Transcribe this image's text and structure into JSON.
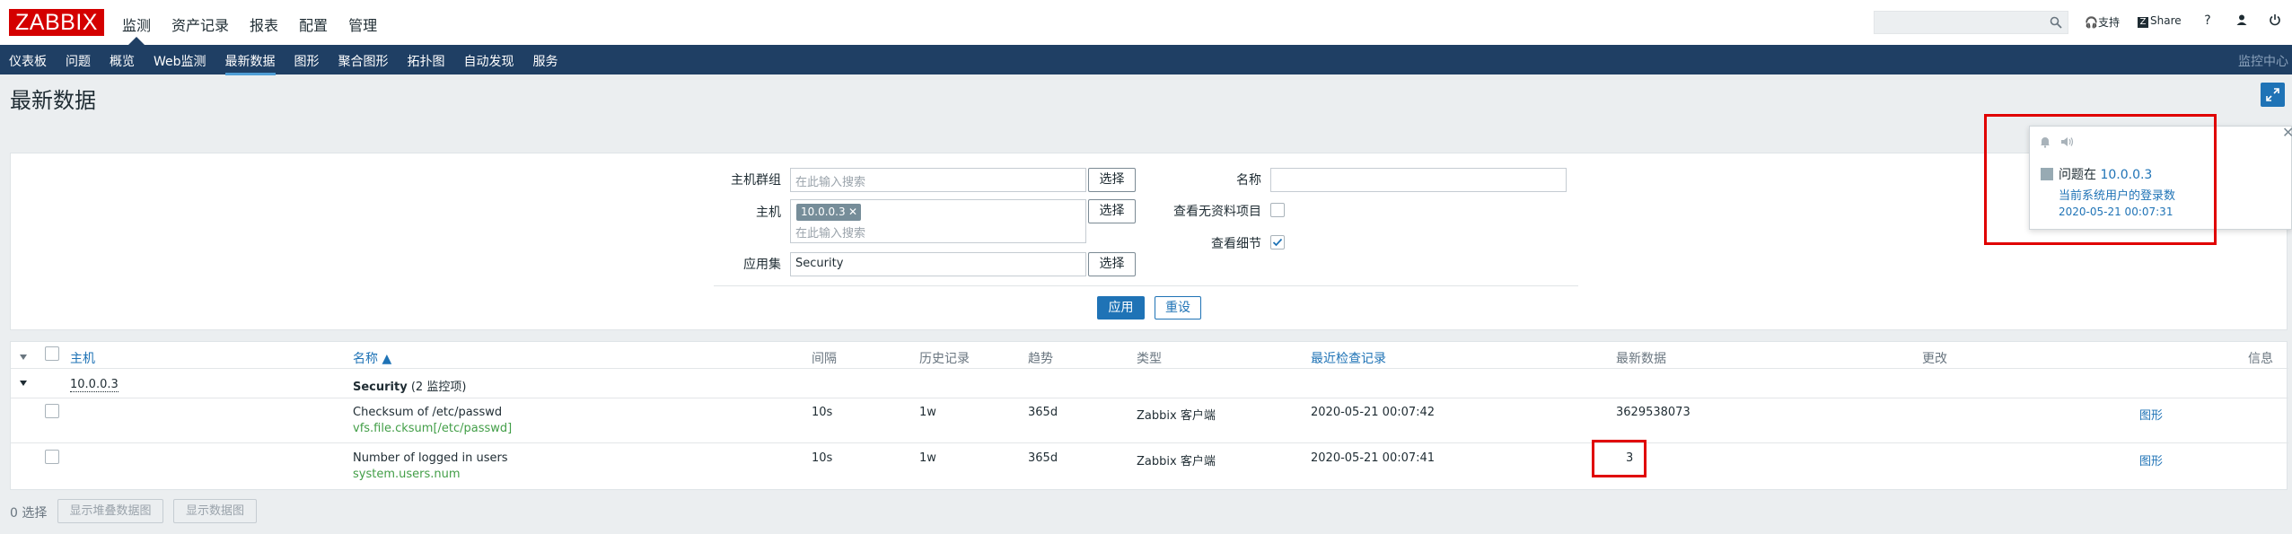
{
  "app": {
    "logo": "ZABBIX"
  },
  "topmenu": [
    "监测",
    "资产记录",
    "报表",
    "配置",
    "管理"
  ],
  "header_right": {
    "support": "支持",
    "share": "Share",
    "help": "?"
  },
  "submenu": [
    "仪表板",
    "问题",
    "概览",
    "Web监测",
    "最新数据",
    "图形",
    "聚合图形",
    "拓扑图",
    "自动发现",
    "服务"
  ],
  "submenu_active": "最新数据",
  "submenu_right": "监控中心",
  "page_title": "最新数据",
  "filter": {
    "host_group_label": "主机群组",
    "host_group_placeholder": "在此输入搜索",
    "host_label": "主机",
    "host_tag": "10.0.0.3",
    "host_placeholder": "在此输入搜索",
    "app_label": "应用集",
    "app_value": "Security",
    "select_label": "选择",
    "name_label": "名称",
    "show_no_data_label": "查看无资料项目",
    "show_details_label": "查看细节",
    "apply": "应用",
    "reset": "重设"
  },
  "table": {
    "headers": {
      "host": "主机",
      "name": "名称 ▲",
      "interval": "间隔",
      "history": "历史记录",
      "trends": "趋势",
      "type": "类型",
      "last_check": "最近检查记录",
      "last_value": "最新数据",
      "change": "更改",
      "info": "信息"
    },
    "group": {
      "host": "10.0.0.3",
      "app": "Security",
      "count": "(2 监控项)"
    },
    "rows": [
      {
        "name": "Checksum of /etc/passwd",
        "key": "vfs.file.cksum[/etc/passwd]",
        "interval": "10s",
        "history": "1w",
        "trends": "365d",
        "type": "Zabbix 客户端",
        "last_check": "2020-05-21 00:07:42",
        "last_value": "3629538073",
        "action": "图形"
      },
      {
        "name": "Number of logged in users",
        "key": "system.users.num",
        "interval": "10s",
        "history": "1w",
        "trends": "365d",
        "type": "Zabbix 客户端",
        "last_check": "2020-05-21 00:07:41",
        "last_value": "3",
        "action": "图形"
      }
    ]
  },
  "footer": {
    "selected": "0 选择",
    "stacked_graph": "显示堆叠数据图",
    "graph": "显示数据图"
  },
  "popup": {
    "problem_prefix": "问题在",
    "host": "10.0.0.3",
    "message": "当前系统用户的登录数",
    "time": "2020-05-21 00:07:31"
  },
  "colors": {
    "brand": "#d40000",
    "nav": "#1f3f64",
    "accent": "#1f73b6",
    "highlight": "#e00000"
  }
}
